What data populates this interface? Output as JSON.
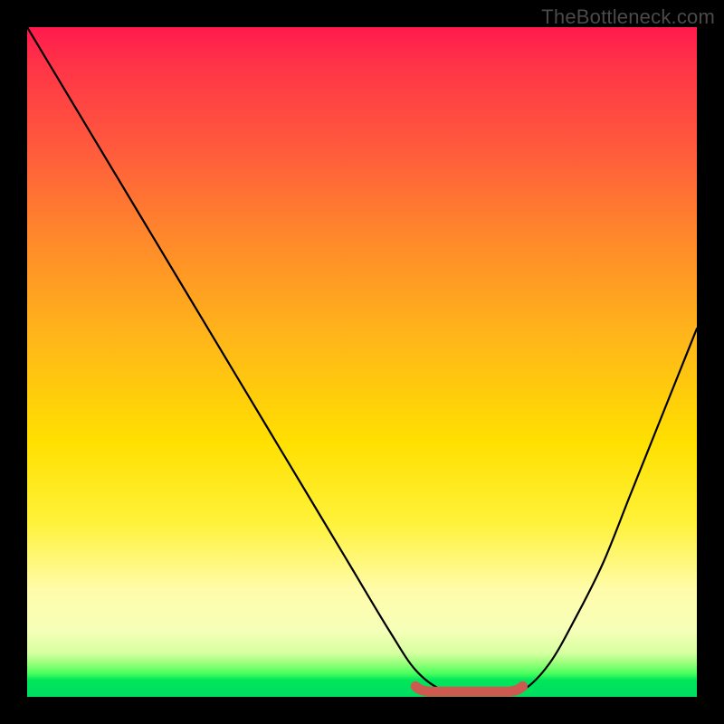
{
  "watermark": "TheBottleneck.com",
  "colors": {
    "curve": "#000000",
    "valley_marker": "#cc5a50",
    "frame": "#000000"
  },
  "chart_data": {
    "type": "line",
    "title": "",
    "xlabel": "",
    "ylabel": "",
    "xlim": [
      0,
      100
    ],
    "ylim": [
      0,
      100
    ],
    "grid": false,
    "legend": false,
    "series": [
      {
        "name": "bottleneck-curve",
        "x": [
          0,
          6,
          12,
          18,
          24,
          30,
          36,
          42,
          48,
          54,
          58,
          62,
          66,
          70,
          74,
          78,
          82,
          86,
          90,
          94,
          100
        ],
        "y": [
          100,
          90,
          80,
          70,
          60,
          50,
          40,
          30,
          20,
          10,
          4,
          1,
          0.5,
          0.5,
          1,
          5,
          12,
          20,
          30,
          40,
          55
        ]
      }
    ],
    "annotations": [
      {
        "name": "optimal-range",
        "x_start": 58,
        "x_end": 74,
        "y": 0.5
      }
    ],
    "background_gradient_stops": [
      {
        "pos": 0.0,
        "color": "#ff1a4d"
      },
      {
        "pos": 0.3,
        "color": "#ff8a2a"
      },
      {
        "pos": 0.62,
        "color": "#ffe000"
      },
      {
        "pos": 0.9,
        "color": "#f6ffb8"
      },
      {
        "pos": 1.0,
        "color": "#00dc63"
      }
    ]
  }
}
